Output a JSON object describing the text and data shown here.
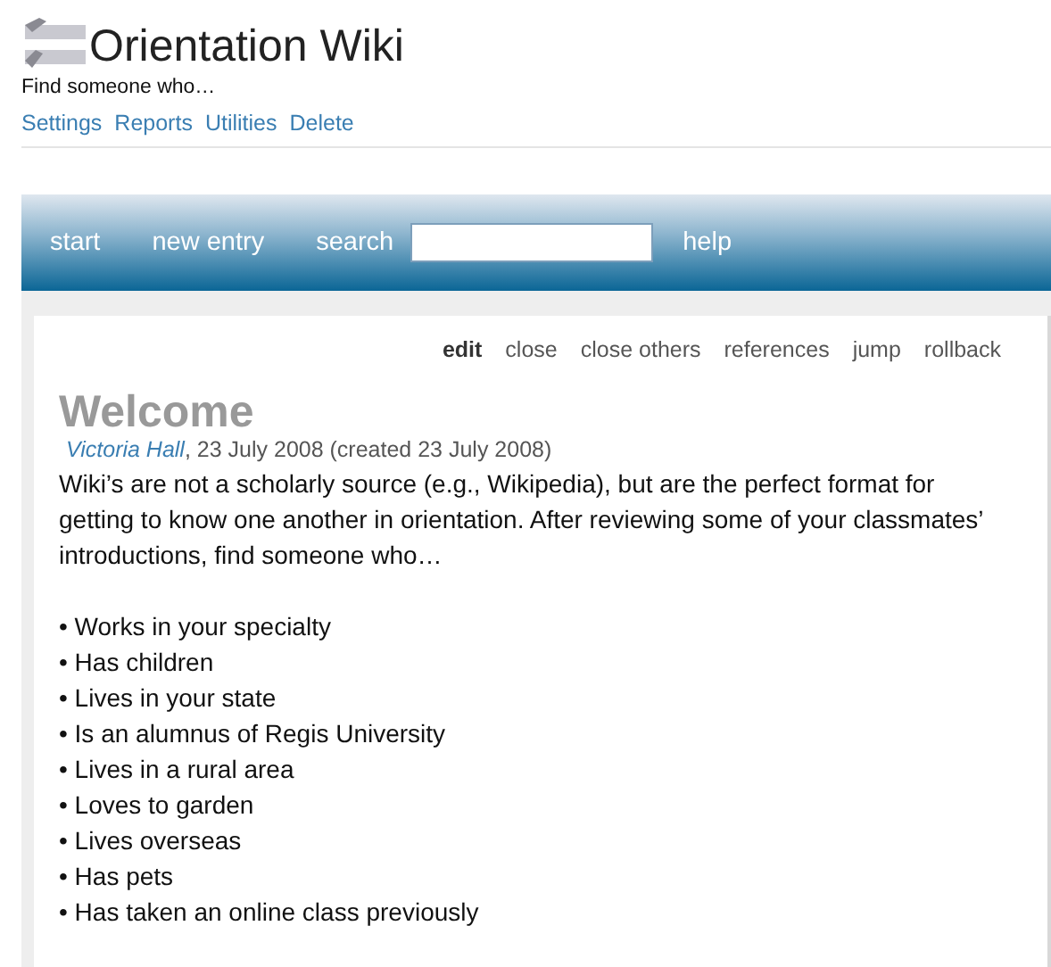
{
  "site": {
    "title": "Orientation Wiki",
    "subtitle": "Find someone who…"
  },
  "admin_links": [
    "Settings",
    "Reports",
    "Utilities",
    "Delete"
  ],
  "nav": {
    "items": [
      {
        "label": "start"
      },
      {
        "label": "new entry"
      }
    ],
    "search_label": "search",
    "after": [
      {
        "label": "help"
      }
    ]
  },
  "tiddler": {
    "toolbar": [
      {
        "label": "edit",
        "selected": true
      },
      {
        "label": "close",
        "selected": false
      },
      {
        "label": "close others",
        "selected": false
      },
      {
        "label": "references",
        "selected": false
      },
      {
        "label": "jump",
        "selected": false
      },
      {
        "label": "rollback",
        "selected": false
      }
    ],
    "title": "Welcome",
    "author": "Victoria Hall",
    "byline": ", 23 July 2008 (created 23 July 2008)",
    "body": "Wiki’s are not a scholarly source (e.g., Wikipedia), but are the perfect format for getting to know one another in orientation. After reviewing some of your classmates’ introductions, find someone who…",
    "list": [
      "• Works in your specialty",
      "• Has children",
      "• Lives in your state",
      "• Is an alumnus of Regis University",
      "• Lives in a rural area",
      "• Loves to garden",
      "• Lives overseas",
      "• Has pets",
      "• Has taken an online class previously"
    ]
  }
}
